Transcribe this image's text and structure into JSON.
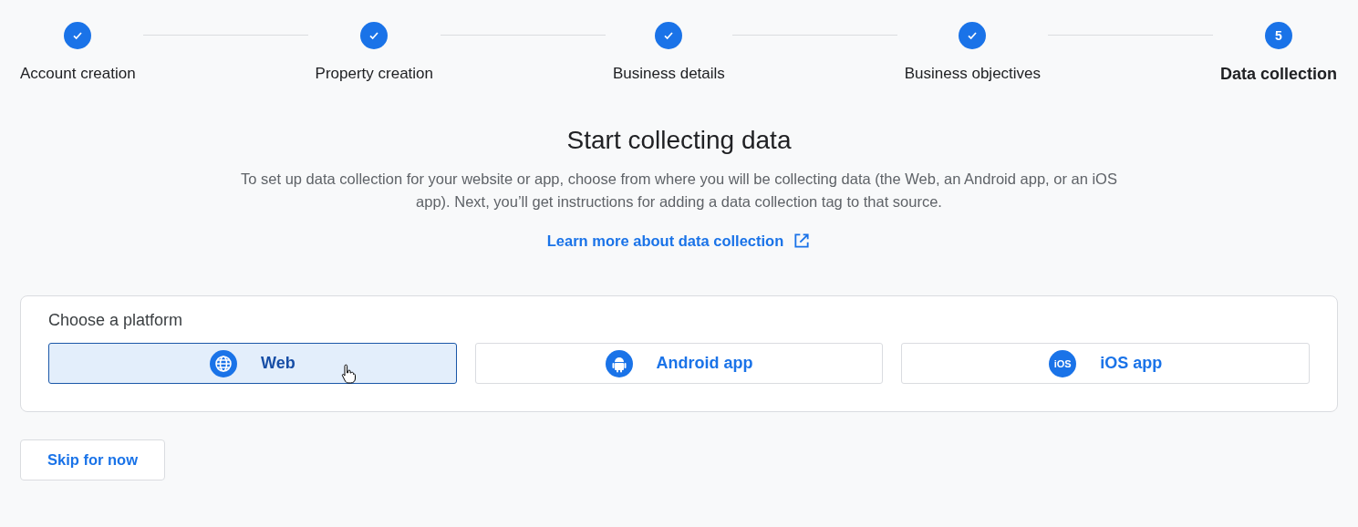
{
  "steps": [
    {
      "label": "Account creation",
      "completed": true,
      "selected": false
    },
    {
      "label": "Property creation",
      "completed": true,
      "selected": false
    },
    {
      "label": "Business details",
      "completed": true,
      "selected": false
    },
    {
      "label": "Business objectives",
      "completed": true,
      "selected": false
    },
    {
      "label": "Data collection",
      "completed": false,
      "number": "5",
      "selected": true
    }
  ],
  "heading": "Start collecting data",
  "description": "To set up data collection for your website or app, choose from where you will be collecting data (the Web, an Android app, or an iOS app). Next, you’ll get instructions for adding a data collection tag to that source.",
  "learn_more_link": "Learn more about data collection",
  "platform_card": {
    "title": "Choose a platform",
    "options": [
      {
        "kind": "web",
        "label": "Web",
        "selected": true
      },
      {
        "kind": "android",
        "label": "Android app",
        "selected": false
      },
      {
        "kind": "ios",
        "label": "iOS app",
        "icon_text": "iOS",
        "selected": false
      }
    ]
  },
  "skip_button": "Skip for now"
}
